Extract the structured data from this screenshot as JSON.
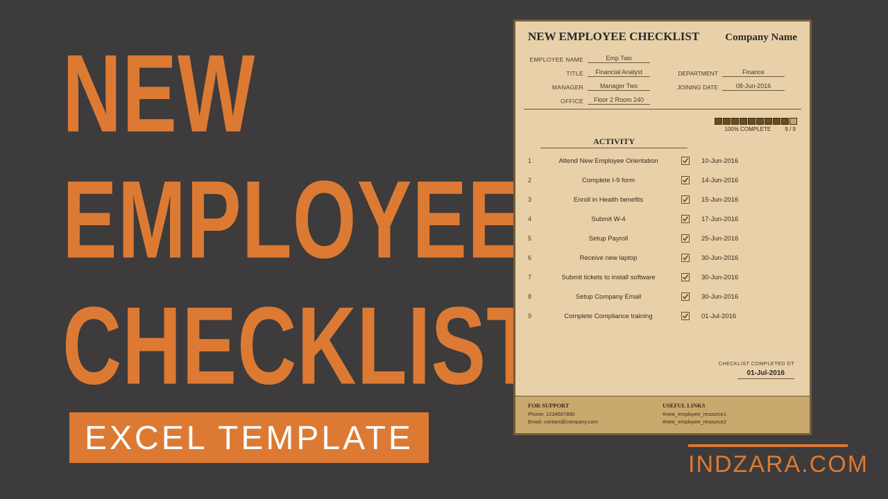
{
  "title": {
    "l1": "NEW",
    "l2": "EMPLOYEE",
    "l3": "CHECKLIST"
  },
  "badge": "EXCEL TEMPLATE",
  "brand": "INDZARA.COM",
  "doc": {
    "heading": "NEW EMPLOYEE CHECKLIST",
    "company": "Company Name",
    "labels": {
      "employee": "EMPLOYEE NAME",
      "title": "TITLE",
      "manager": "MANAGER",
      "office": "OFFICE",
      "department": "DEPARTMENT",
      "joining": "JOINING DATE"
    },
    "values": {
      "employee": "Emp Two",
      "title": "Financial Analyst",
      "manager": "Manager Two",
      "office": "Floor 2 Room 240",
      "department": "Finance",
      "joining": "08-Jun-2016"
    },
    "progress_pct": "100%  COMPLETE",
    "progress_ratio": "9 / 9",
    "activity_header": "ACTIVITY",
    "activities": [
      {
        "n": "1",
        "label": "Attend New Employee Orientation",
        "date": "10-Jun-2016"
      },
      {
        "n": "2",
        "label": "Complete I-9 form",
        "date": "14-Jun-2016"
      },
      {
        "n": "3",
        "label": "Enroll in Health benefits",
        "date": "15-Jun-2016"
      },
      {
        "n": "4",
        "label": "Submit W-4",
        "date": "17-Jun-2016"
      },
      {
        "n": "5",
        "label": "Setup Payroll",
        "date": "25-Jun-2016"
      },
      {
        "n": "6",
        "label": "Receive new laptop",
        "date": "30-Jun-2016"
      },
      {
        "n": "7",
        "label": "Submit tickets to install software",
        "date": "30-Jun-2016"
      },
      {
        "n": "8",
        "label": "Setup Company Email",
        "date": "30-Jun-2016"
      },
      {
        "n": "9",
        "label": "Complete Compliance training",
        "date": "01-Jul-2016"
      }
    ],
    "completed_label": "CHECKLIST COMPLETED DT",
    "completed_date": "01-Jul-2016",
    "footer": {
      "support_head": "FOR SUPPORT",
      "support_phone": "Phone: 1234567890",
      "support_email": "Email: contact@company.com",
      "links_head": "USEFUL LINKS",
      "link1": "#new_employee_resource1",
      "link2": "#new_employee_resource2"
    }
  }
}
